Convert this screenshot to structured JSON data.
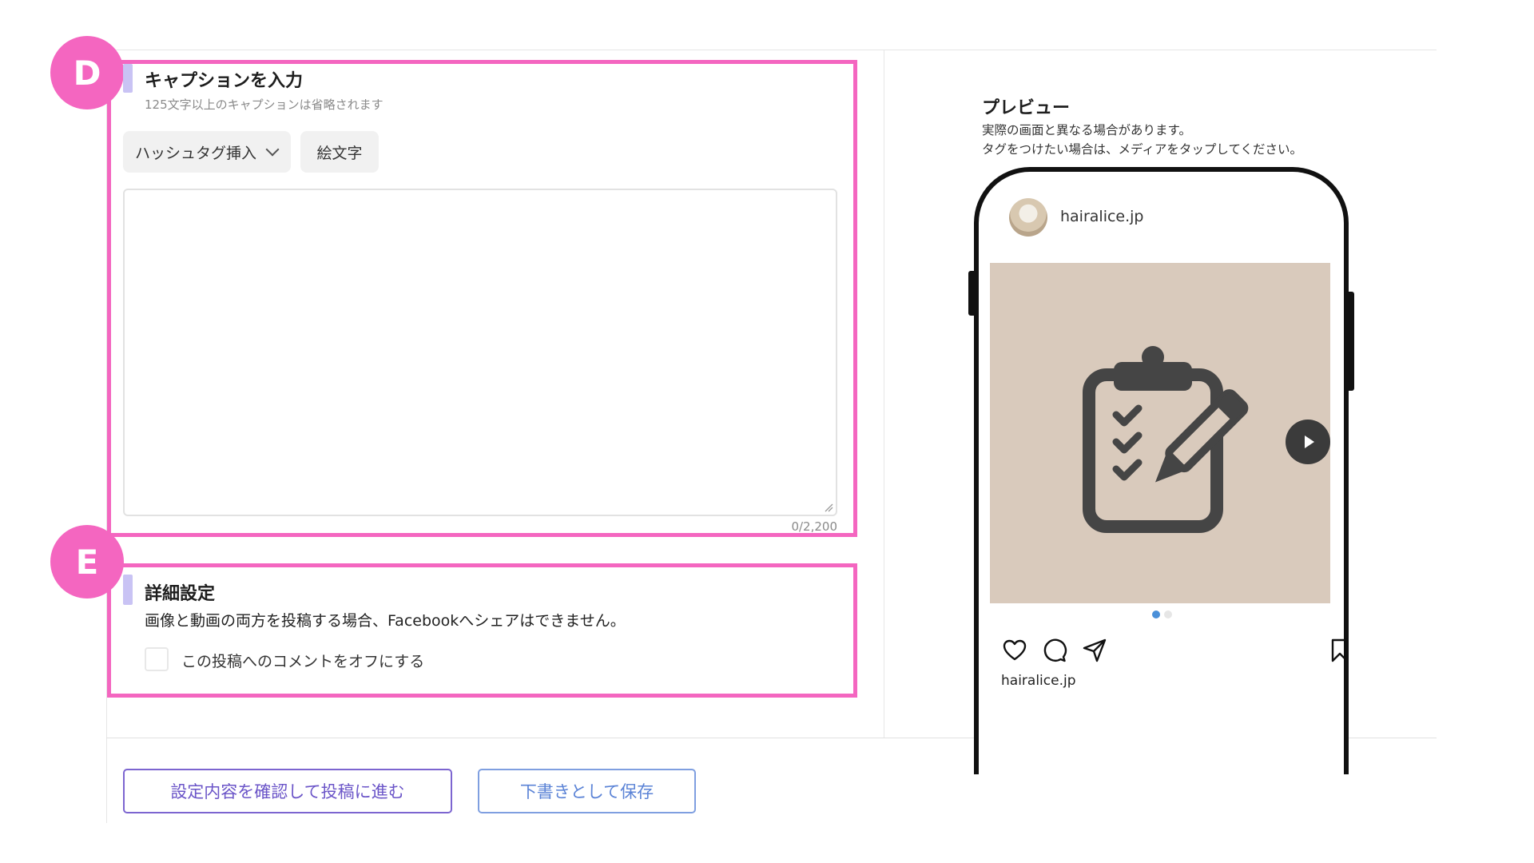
{
  "annotations": {
    "d": "D",
    "e": "E"
  },
  "caption_section": {
    "title": "キャプションを入力",
    "hint": "125文字以上のキャプションは省略されます",
    "hashtag_button": "ハッシュタグ挿入",
    "emoji_button": "絵文字",
    "caption_value": "",
    "counter": "0/2,200"
  },
  "detail_section": {
    "title": "詳細設定",
    "description": "画像と動画の両方を投稿する場合、Facebookへシェアはできません。",
    "comment_off_label": "この投稿へのコメントをオフにする",
    "comment_off_checked": false
  },
  "footer": {
    "confirm_button": "設定内容を確認して投稿に進む",
    "draft_button": "下書きとして保存"
  },
  "preview": {
    "title": "プレビュー",
    "note_line1": "実際の画面と異なる場合があります。",
    "note_line2": "タグをつけたい場合は、メディアをタップしてください。",
    "account_handle": "hairalice.jp",
    "caption_handle": "hairalice.jp",
    "media_icon": "clipboard-checklist-pen-icon",
    "carousel_active_index": 0,
    "carousel_count": 2
  },
  "colors": {
    "annotation": "#f466c0",
    "accent_bar": "#c9c3f4",
    "media_background": "#d9cabc",
    "primary_button": "#6b55c8",
    "draft_button": "#5b83d6",
    "dot_active": "#4a90d9"
  }
}
